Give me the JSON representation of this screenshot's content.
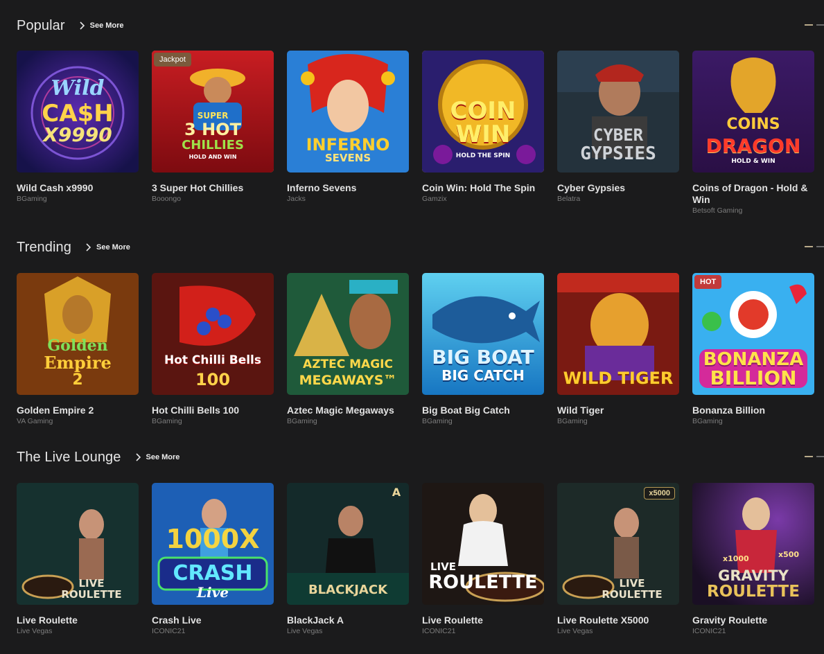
{
  "sections": [
    {
      "title": "Popular",
      "see_more": "See More",
      "games": [
        {
          "name": "Wild Cash x9990",
          "provider": "BGaming",
          "art": [
            "Wild",
            "CA$H",
            "X9990"
          ]
        },
        {
          "name": "3 Super Hot Chillies",
          "provider": "Booongo",
          "badge": "Jackpot",
          "art": [
            "SUPER",
            "3 HOT",
            "CHILLIES",
            "HOLD AND WIN"
          ]
        },
        {
          "name": "Inferno Sevens",
          "provider": "Jacks",
          "art": [
            "INFERNO",
            "SEVENS"
          ]
        },
        {
          "name": "Coin Win: Hold The Spin",
          "provider": "Gamzix",
          "art": [
            "COIN",
            "WIN",
            "HOLD THE SPIN"
          ]
        },
        {
          "name": "Cyber Gypsies",
          "provider": "Belatra",
          "art": [
            "CYBER",
            "GYPSIES"
          ]
        },
        {
          "name": "Coins of Dragon - Hold & Win",
          "provider": "Betsoft Gaming",
          "art": [
            "COINS",
            "DRAGON",
            "HOLD & WIN"
          ]
        }
      ]
    },
    {
      "title": "Trending",
      "see_more": "See More",
      "games": [
        {
          "name": "Golden Empire 2",
          "provider": "VA Gaming",
          "art": [
            "Golden",
            "Empire",
            "2"
          ]
        },
        {
          "name": "Hot Chilli Bells 100",
          "provider": "BGaming",
          "art": [
            "Hot Chilli Bells",
            "100"
          ]
        },
        {
          "name": "Aztec Magic Megaways",
          "provider": "BGaming",
          "art": [
            "AZTEC MAGIC",
            "MEGAWAYS™"
          ]
        },
        {
          "name": "Big Boat Big Catch",
          "provider": "BGaming",
          "art": [
            "BIG BOAT",
            "BIG CATCH"
          ]
        },
        {
          "name": "Wild Tiger",
          "provider": "BGaming",
          "art": [
            "WILD TIGER"
          ]
        },
        {
          "name": "Bonanza Billion",
          "provider": "BGaming",
          "badge": "HOT",
          "art": [
            "BONANZA",
            "BILLION"
          ]
        }
      ]
    },
    {
      "title": "The Live Lounge",
      "see_more": "See More",
      "games": [
        {
          "name": "Live Roulette",
          "provider": "Live Vegas",
          "art": [
            "LIVE",
            "ROULETTE"
          ]
        },
        {
          "name": "Crash Live",
          "provider": "ICONIC21",
          "art": [
            "1000X",
            "CRASH",
            "Live"
          ]
        },
        {
          "name": "BlackJack A",
          "provider": "Live Vegas",
          "art": [
            "BLACKJACK",
            "A"
          ]
        },
        {
          "name": "Live Roulette",
          "provider": "ICONIC21",
          "art": [
            "LIVE",
            "ROULETTE"
          ]
        },
        {
          "name": "Live Roulette X5000",
          "provider": "Live Vegas",
          "badge": "x5000",
          "art": [
            "LIVE",
            "ROULETTE"
          ]
        },
        {
          "name": "Gravity Roulette",
          "provider": "ICONIC21",
          "art": [
            "x1000",
            "x500",
            "GRAVITY",
            "ROULETTE"
          ]
        }
      ]
    }
  ],
  "colors": {
    "background": "#1b1b1c",
    "accent_gold": "#e6b43a",
    "provider_text": "#7d7d7d",
    "hot_badge": "#c23a3a"
  },
  "icons": {
    "see_more": "chevron-right-icon",
    "carousel_nav": "carousel-dash-icon"
  }
}
